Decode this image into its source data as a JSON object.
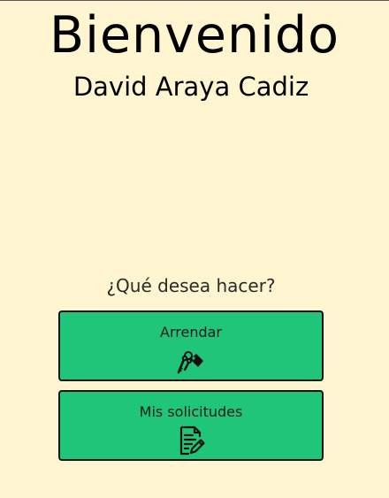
{
  "header": {
    "title": "Bienvenido",
    "user_name": "David Araya Cadiz"
  },
  "main": {
    "question": "¿Qué desea hacer?",
    "actions": [
      {
        "label": "Arrendar",
        "icon": "keys-icon"
      },
      {
        "label": "Mis solicitudes",
        "icon": "document-edit-icon"
      }
    ]
  },
  "colors": {
    "background": "#fff5d1",
    "button": "#1fc679",
    "button_border": "#111111"
  }
}
